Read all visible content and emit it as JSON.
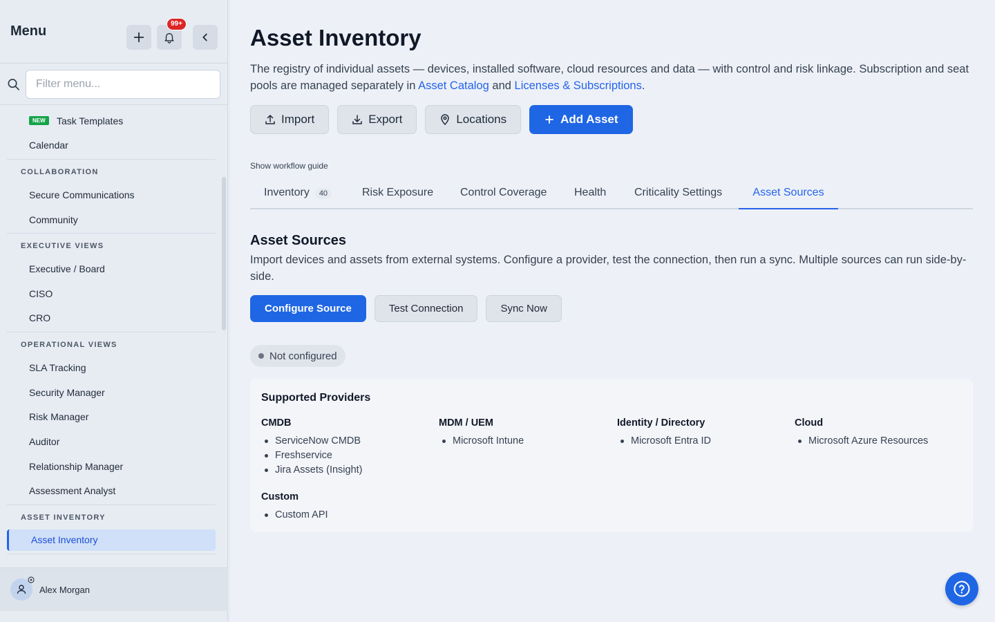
{
  "sidebar": {
    "title": "Menu",
    "notification_count": "99+",
    "filter_placeholder": "Filter menu...",
    "new_tag": "NEW",
    "items_top": [
      "Task Templates",
      "Calendar"
    ],
    "sections": [
      {
        "heading": "COLLABORATION",
        "items": [
          "Secure Communications",
          "Community"
        ]
      },
      {
        "heading": "EXECUTIVE VIEWS",
        "items": [
          "Executive / Board",
          "CISO",
          "CRO"
        ]
      },
      {
        "heading": "OPERATIONAL VIEWS",
        "items": [
          "SLA Tracking",
          "Security Manager",
          "Risk Manager",
          "Auditor",
          "Relationship Manager",
          "Assessment Analyst"
        ]
      },
      {
        "heading": "ASSET INVENTORY",
        "items": [
          "Asset Inventory"
        ]
      }
    ],
    "user_name": "Alex Morgan"
  },
  "page": {
    "title": "Asset Inventory",
    "desc_part1": "The registry of individual assets — devices, installed software, cloud resources and data — with control and risk linkage. Subscription and seat pools are managed separately in ",
    "desc_link1": "Asset Catalog",
    "desc_and": " and ",
    "desc_link2": "Licenses & Subscriptions",
    "desc_end": ".",
    "actions": {
      "import": "Import",
      "export": "Export",
      "locations": "Locations",
      "add_asset": "Add Asset"
    },
    "guide": "Show workflow guide"
  },
  "tabs": {
    "inventory": "Inventory",
    "inventory_count": "40",
    "risk": "Risk Exposure",
    "control": "Control Coverage",
    "health": "Health",
    "criticality": "Criticality Settings",
    "sources": "Asset Sources"
  },
  "asset_sources": {
    "title": "Asset Sources",
    "description": "Import devices and assets from external systems. Configure a provider, test the connection, then run a sync. Multiple sources can run side-by-side.",
    "configure": "Configure Source",
    "test": "Test Connection",
    "sync": "Sync Now",
    "status": "Not configured",
    "providers_title": "Supported Providers",
    "providers": {
      "cmdb": {
        "heading": "CMDB",
        "items": [
          "ServiceNow CMDB",
          "Freshservice",
          "Jira Assets (Insight)"
        ]
      },
      "mdm": {
        "heading": "MDM / UEM",
        "items": [
          "Microsoft Intune"
        ]
      },
      "identity": {
        "heading": "Identity / Directory",
        "items": [
          "Microsoft Entra ID"
        ]
      },
      "cloud": {
        "heading": "Cloud",
        "items": [
          "Microsoft Azure Resources"
        ]
      },
      "custom": {
        "heading": "Custom",
        "items": [
          "Custom API"
        ]
      }
    }
  },
  "colors": {
    "accent": "#1f66e5",
    "badge": "#dc2626",
    "new_tag": "#16a34a"
  }
}
